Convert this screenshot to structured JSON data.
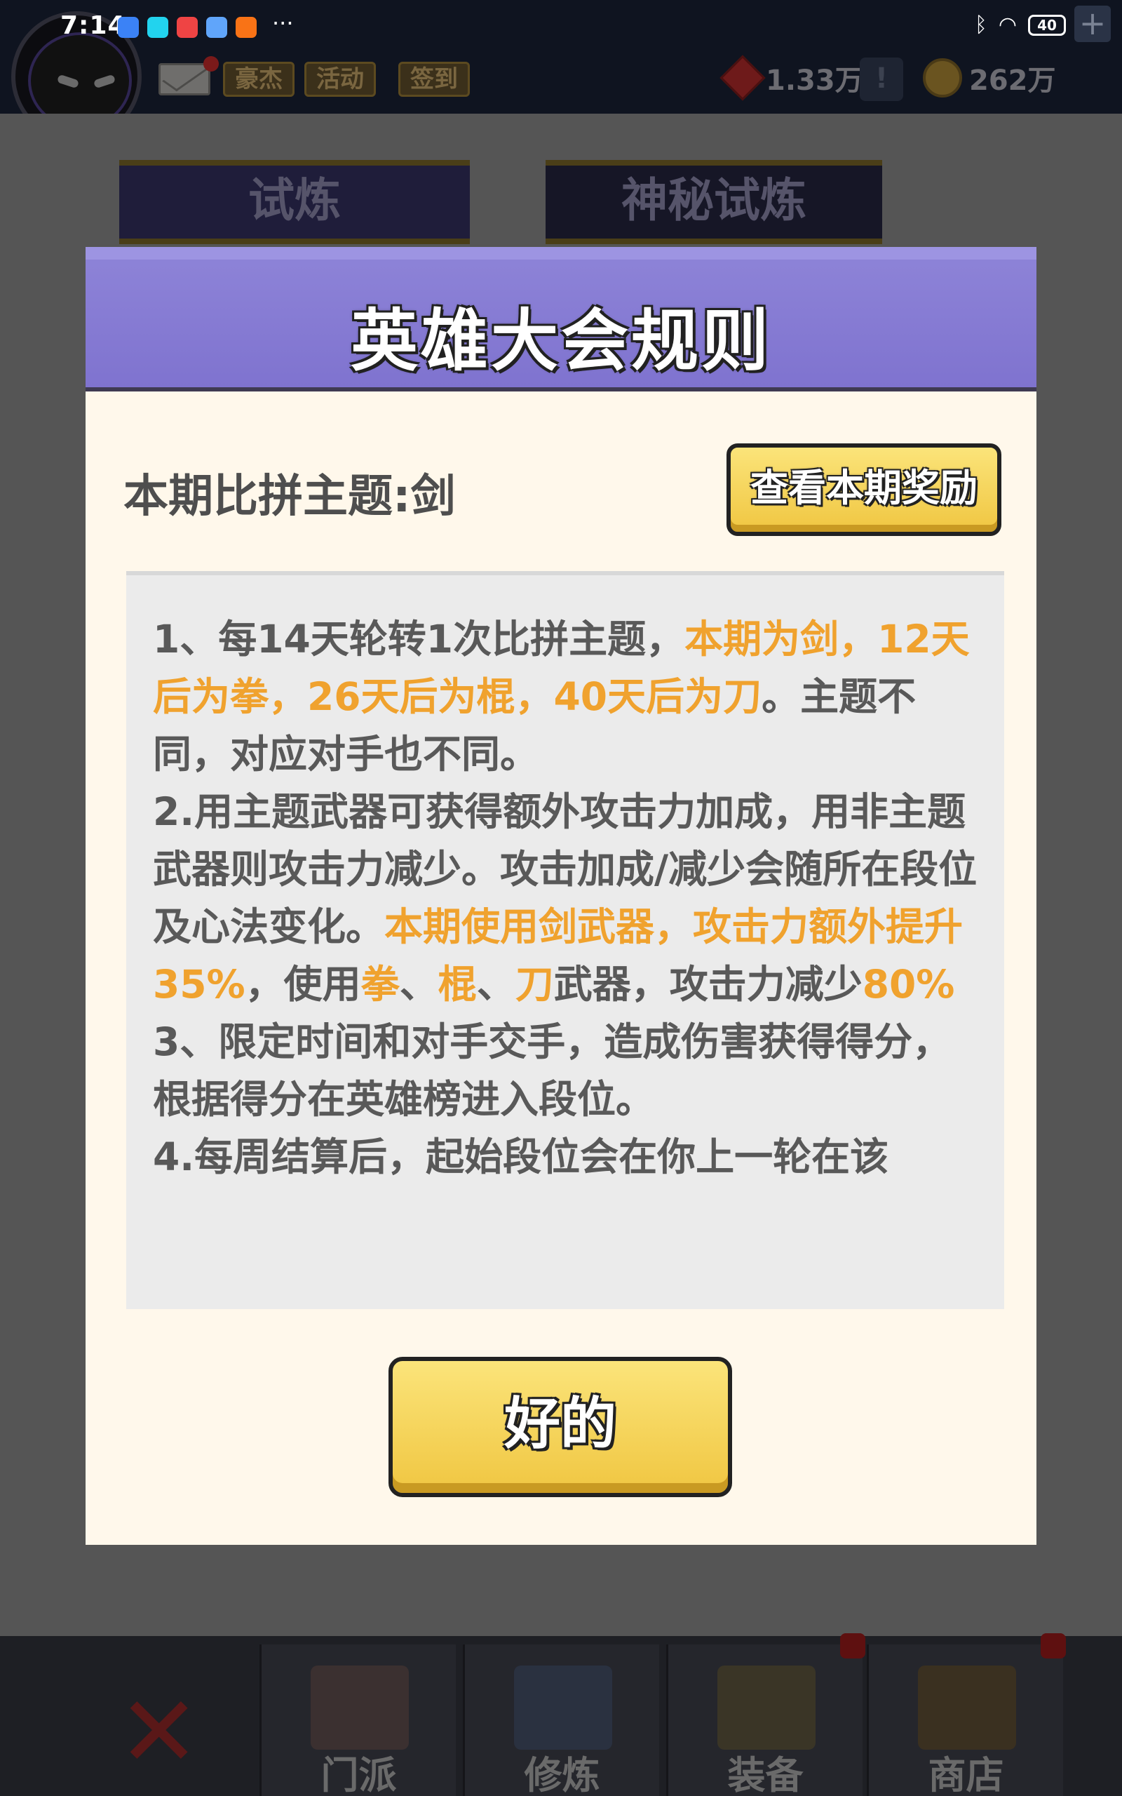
{
  "status_bar": {
    "time": "7:14",
    "more": "···",
    "battery": "40",
    "app_icon_colors": [
      "#3b82f6",
      "#22d3ee",
      "#ef4444",
      "#60a5fa",
      "#f97316"
    ]
  },
  "top_bar": {
    "pills": [
      "豪杰",
      "活动",
      "签到"
    ],
    "gems": "1.33万",
    "add_symbol": "!",
    "coins": "262万",
    "plus": "+"
  },
  "background_tabs": {
    "trial": "试炼",
    "mystery_trial": "神秘试炼"
  },
  "dialog": {
    "title": "英雄大会规则",
    "theme_label": "本期比拼主题:剑",
    "rewards_button": "查看本期奖励",
    "rules": [
      [
        {
          "t": "1、每14天轮转1次比拼主题，",
          "hl": false
        },
        {
          "t": "本期为剑，12天后为拳，26天后为棍，40天后为刀",
          "hl": true
        },
        {
          "t": "。主题不同，对应对手也不同。",
          "hl": false
        }
      ],
      [
        {
          "t": "2.用主题武器可获得额外攻击力加成，用非主题武器则攻击力减少。攻击加成/减少会随所在段位及心法变化。",
          "hl": false
        },
        {
          "t": "本期使用剑武器，攻击力额外提升35%",
          "hl": true
        },
        {
          "t": "，使用",
          "hl": false
        },
        {
          "t": "拳",
          "hl": true
        },
        {
          "t": "、",
          "hl": false
        },
        {
          "t": "棍",
          "hl": true
        },
        {
          "t": "、",
          "hl": false
        },
        {
          "t": "刀",
          "hl": true
        },
        {
          "t": "武器，攻击力减少",
          "hl": false
        },
        {
          "t": "80%",
          "hl": true
        }
      ],
      [
        {
          "t": "3、限定时间和对手交手，造成伤害获得得分，根据得分在英雄榜进入段位。",
          "hl": false
        }
      ],
      [
        {
          "t": "4.每周结算后，起始段位会在你上一轮在该",
          "hl": false
        }
      ]
    ],
    "ok_button": "好的",
    "highlight_color": "#f0a22e"
  },
  "bottom_nav": {
    "close_symbol": "✕",
    "tabs": [
      "门派",
      "修炼",
      "装备",
      "商店"
    ]
  }
}
